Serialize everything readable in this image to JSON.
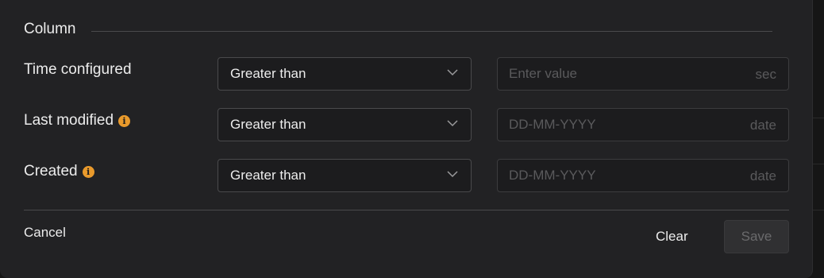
{
  "section": {
    "title": "Column"
  },
  "rows": [
    {
      "label": "Time configured",
      "has_info": false,
      "operator": "Greater than",
      "value": "",
      "placeholder": "Enter value",
      "unit": "sec"
    },
    {
      "label": "Last modified",
      "has_info": true,
      "operator": "Greater than",
      "value": "",
      "placeholder": "DD-MM-YYYY",
      "unit": "date"
    },
    {
      "label": "Created",
      "has_info": true,
      "operator": "Greater than",
      "value": "",
      "placeholder": "DD-MM-YYYY",
      "unit": "date"
    }
  ],
  "footer": {
    "cancel_label": "Cancel",
    "clear_label": "Clear",
    "save_label": "Save"
  },
  "icons": {
    "info": "info-icon",
    "dropdown": "chevron-down-icon"
  },
  "colors": {
    "panel_bg": "#222224",
    "info_accent": "#e99a2c",
    "text": "#ececec",
    "placeholder": "#5a5a5c"
  }
}
